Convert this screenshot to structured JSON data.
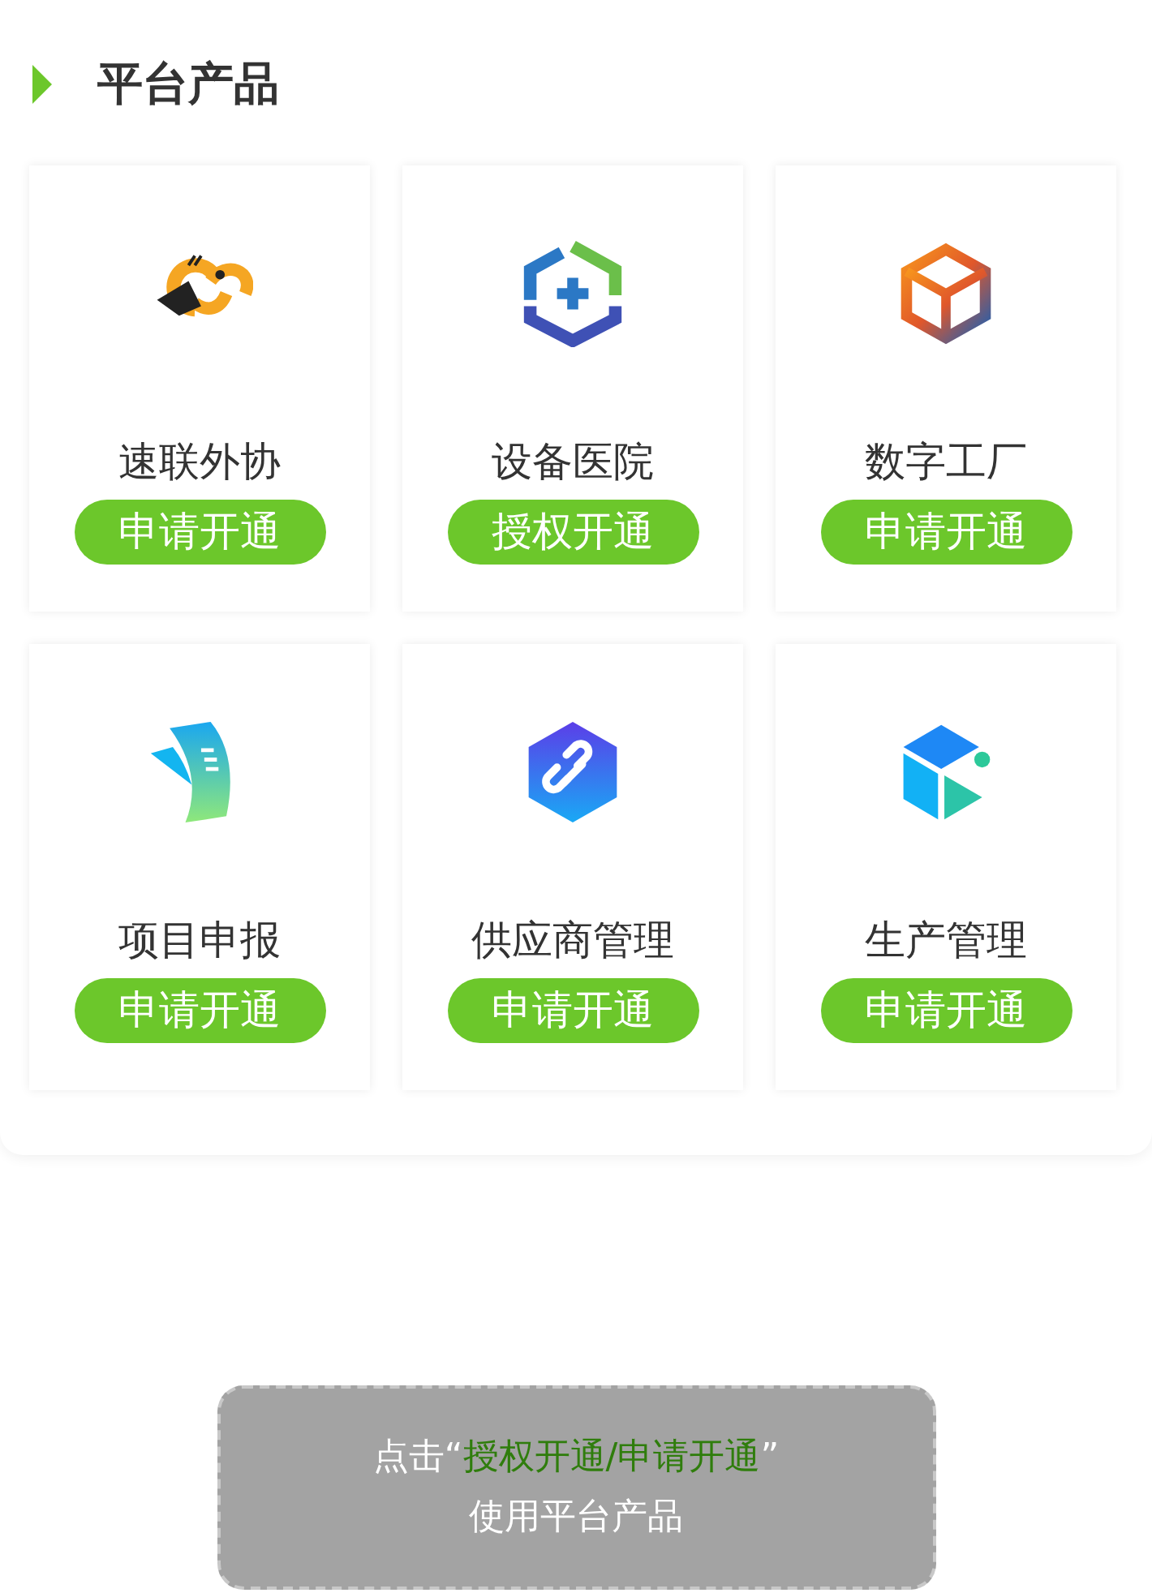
{
  "section": {
    "title": "平台产品"
  },
  "products": [
    {
      "name": "速联外协",
      "action": "申请开通"
    },
    {
      "name": "设备医院",
      "action": "授权开通"
    },
    {
      "name": "数字工厂",
      "action": "申请开通"
    },
    {
      "name": "项目申报",
      "action": "申请开通"
    },
    {
      "name": "供应商管理",
      "action": "申请开通"
    },
    {
      "name": "生产管理",
      "action": "申请开通"
    }
  ],
  "hint": {
    "lead": "点击“",
    "highlight": "授权开通/申请开通",
    "tail": "”",
    "line2": "使用平台产品"
  }
}
